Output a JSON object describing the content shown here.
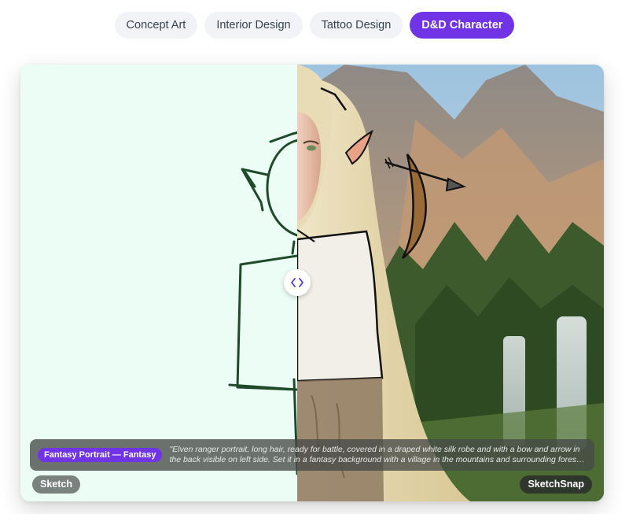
{
  "tabs": [
    {
      "label": "Concept Art",
      "active": false
    },
    {
      "label": "Interior Design",
      "active": false
    },
    {
      "label": "Tattoo Design",
      "active": false
    },
    {
      "label": "D&D Character",
      "active": true
    }
  ],
  "comparison": {
    "handle_icon": "chevrons-left-right-icon",
    "left_label": "Sketch",
    "right_label": "SketchSnap"
  },
  "caption": {
    "badge": "Fantasy Portrait — Fantasy",
    "prompt": "\"Elven ranger portrait, long hair, ready for battle, covered in a draped white silk robe and with a bow and arrow in the back visible on left side. Set it in a fantasy background with a village in the mountains and surrounding forest and..."
  },
  "colors": {
    "accent": "#7034e6",
    "tab_bg": "#f1f3f7",
    "sketch_bg": "#ebfdf4",
    "sketch_stroke": "#1f4a2a"
  }
}
